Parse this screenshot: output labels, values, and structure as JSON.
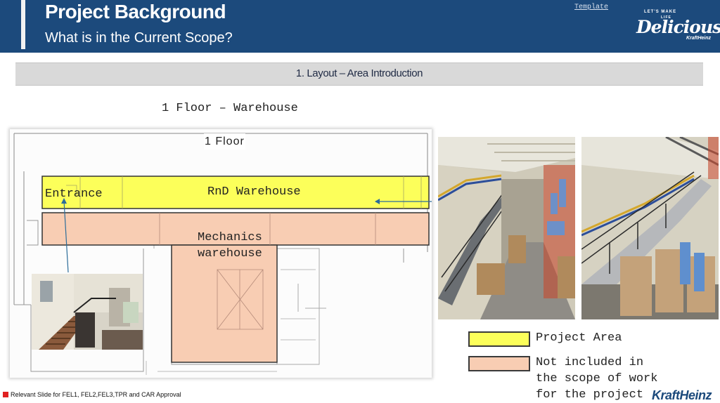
{
  "header": {
    "title": "Project Background",
    "subtitle": "What is in the Current Scope?",
    "template_link": "Template",
    "brand": {
      "tagline": "LET'S MAKE",
      "life": "LIFE",
      "wordmark": "Delicious",
      "company": "KraftHeinz"
    }
  },
  "section": {
    "title": "1. Layout – Area Introduction"
  },
  "floor_caption": "1 Floor – Warehouse",
  "plan": {
    "floor_label": "1 Floor",
    "entrance_label": "Entrance",
    "rnd_label": "RnD Warehouse",
    "mechanics_label_line1": "Mechanics",
    "mechanics_label_line2": "warehouse"
  },
  "legend": {
    "project_area": "Project Area",
    "not_included_line1": "Not included in",
    "not_included_line2": "the scope of work",
    "not_included_line3": "for the project"
  },
  "footer": {
    "note": "Relevant Slide for FEL1, FEL2,FEL3,TPR and CAR Approval",
    "logo": "KraftHeinz"
  },
  "colors": {
    "header_blue": "#1c4a7c",
    "project_area_yellow": "#fcff5a",
    "excluded_salmon": "#f8cdb3",
    "footer_red": "#e02020"
  },
  "icons": {
    "footer_marker": "red-square-icon"
  }
}
